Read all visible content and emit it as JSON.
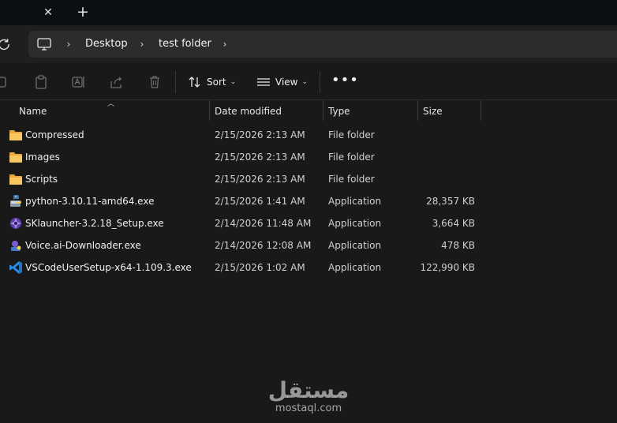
{
  "tabs": {
    "close_icon": "close-icon",
    "new_tab_icon": "plus-icon"
  },
  "address": {
    "root_icon": "this-pc-icon",
    "breadcrumbs": [
      "Desktop",
      "test folder"
    ]
  },
  "command_bar": {
    "sort_label": "Sort",
    "view_label": "View",
    "more_icon": "more-icon"
  },
  "columns": {
    "name": "Name",
    "date": "Date modified",
    "type": "Type",
    "size": "Size"
  },
  "files": [
    {
      "name": "Compressed",
      "date": "2/15/2026 2:13 AM",
      "type": "File folder",
      "size": "",
      "icon": "folder-icon"
    },
    {
      "name": "Images",
      "date": "2/15/2026 2:13 AM",
      "type": "File folder",
      "size": "",
      "icon": "folder-icon"
    },
    {
      "name": "Scripts",
      "date": "2/15/2026 2:13 AM",
      "type": "File folder",
      "size": "",
      "icon": "folder-icon"
    },
    {
      "name": "python-3.10.11-amd64.exe",
      "date": "2/15/2026 1:41 AM",
      "type": "Application",
      "size": "28,357 KB",
      "icon": "python-installer-icon"
    },
    {
      "name": "SKlauncher-3.2.18_Setup.exe",
      "date": "2/14/2026 11:48 AM",
      "type": "Application",
      "size": "3,664 KB",
      "icon": "sklauncher-icon"
    },
    {
      "name": "Voice.ai-Downloader.exe",
      "date": "2/14/2026 12:08 AM",
      "type": "Application",
      "size": "478 KB",
      "icon": "voiceai-icon"
    },
    {
      "name": "VSCodeUserSetup-x64-1.109.3.exe",
      "date": "2/15/2026 1:02 AM",
      "type": "Application",
      "size": "122,990 KB",
      "icon": "vscode-icon"
    }
  ],
  "watermark": {
    "logo_text": "مستقل",
    "url": "mostaql.com"
  },
  "colors": {
    "background": "#191919",
    "tabstrip": "#0b0f14",
    "address_box": "#2c2c2c",
    "folder": "#f2c14e"
  }
}
